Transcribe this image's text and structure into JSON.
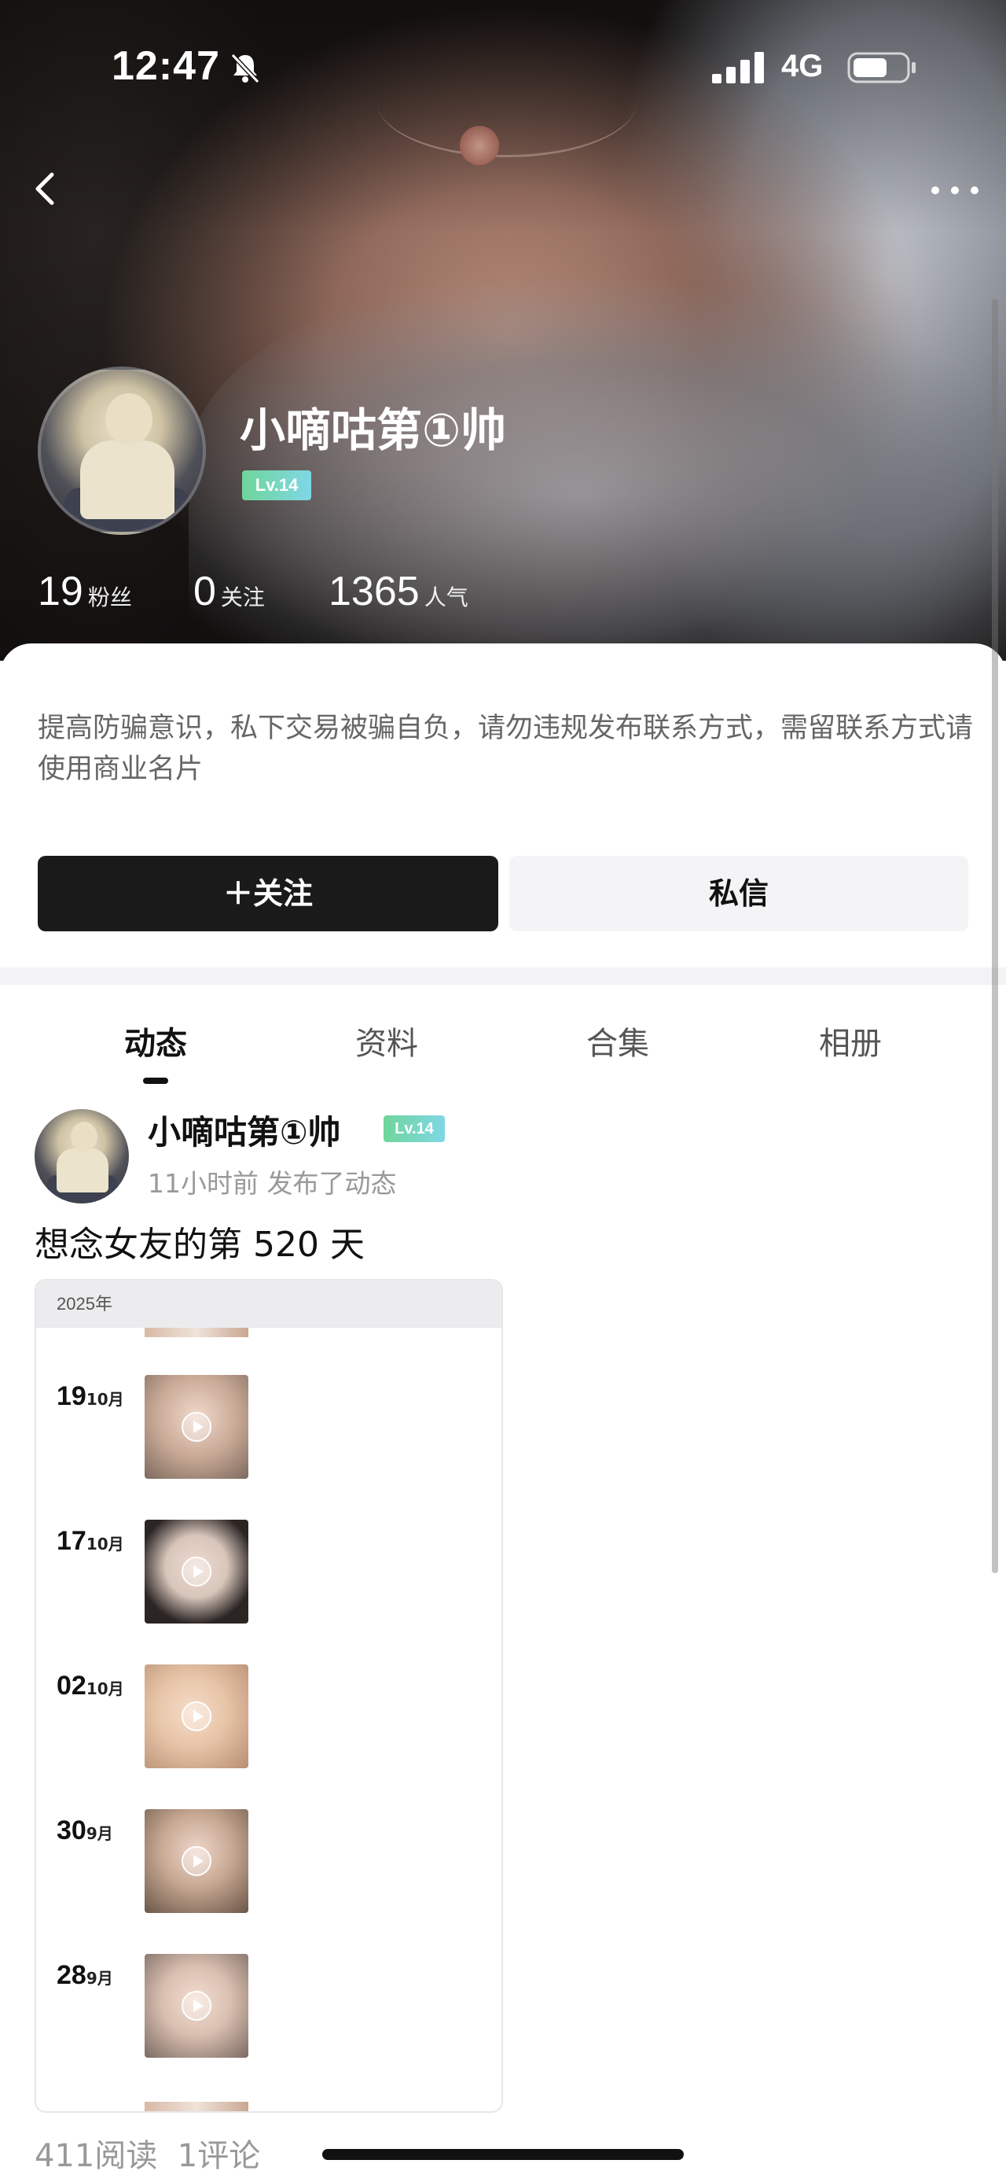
{
  "status_bar": {
    "time": "12:47",
    "network": "4G"
  },
  "profile": {
    "name": "小嘀咕第①帅",
    "level": "Lv.14",
    "stats": [
      {
        "value": "19",
        "label": "粉丝"
      },
      {
        "value": "0",
        "label": "关注"
      },
      {
        "value": "1365",
        "label": "人气"
      }
    ]
  },
  "notice": "提高防骗意识，私下交易被骗自负，请勿违规发布联系方式，需留联系方式请使用商业名片",
  "actions": {
    "follow": "＋关注",
    "message": "私信"
  },
  "tabs": [
    {
      "label": "动态",
      "active": true
    },
    {
      "label": "资料",
      "active": false
    },
    {
      "label": "合集",
      "active": false
    },
    {
      "label": "相册",
      "active": false
    }
  ],
  "post": {
    "author": "小嘀咕第①帅",
    "level": "Lv.14",
    "meta": "11小时前 发布了动态",
    "text": "想念女友的第 520 天",
    "media": {
      "year": "2025年",
      "entries": [
        {
          "day": "19",
          "month": "10月"
        },
        {
          "day": "17",
          "month": "10月"
        },
        {
          "day": "02",
          "month": "10月"
        },
        {
          "day": "30",
          "month": "9月"
        },
        {
          "day": "28",
          "month": "9月"
        }
      ]
    },
    "reads": "411阅读",
    "comments": "1评论"
  },
  "colors": {
    "primary_button": "#1a1a1a",
    "level_badge": "#6fd69a"
  }
}
